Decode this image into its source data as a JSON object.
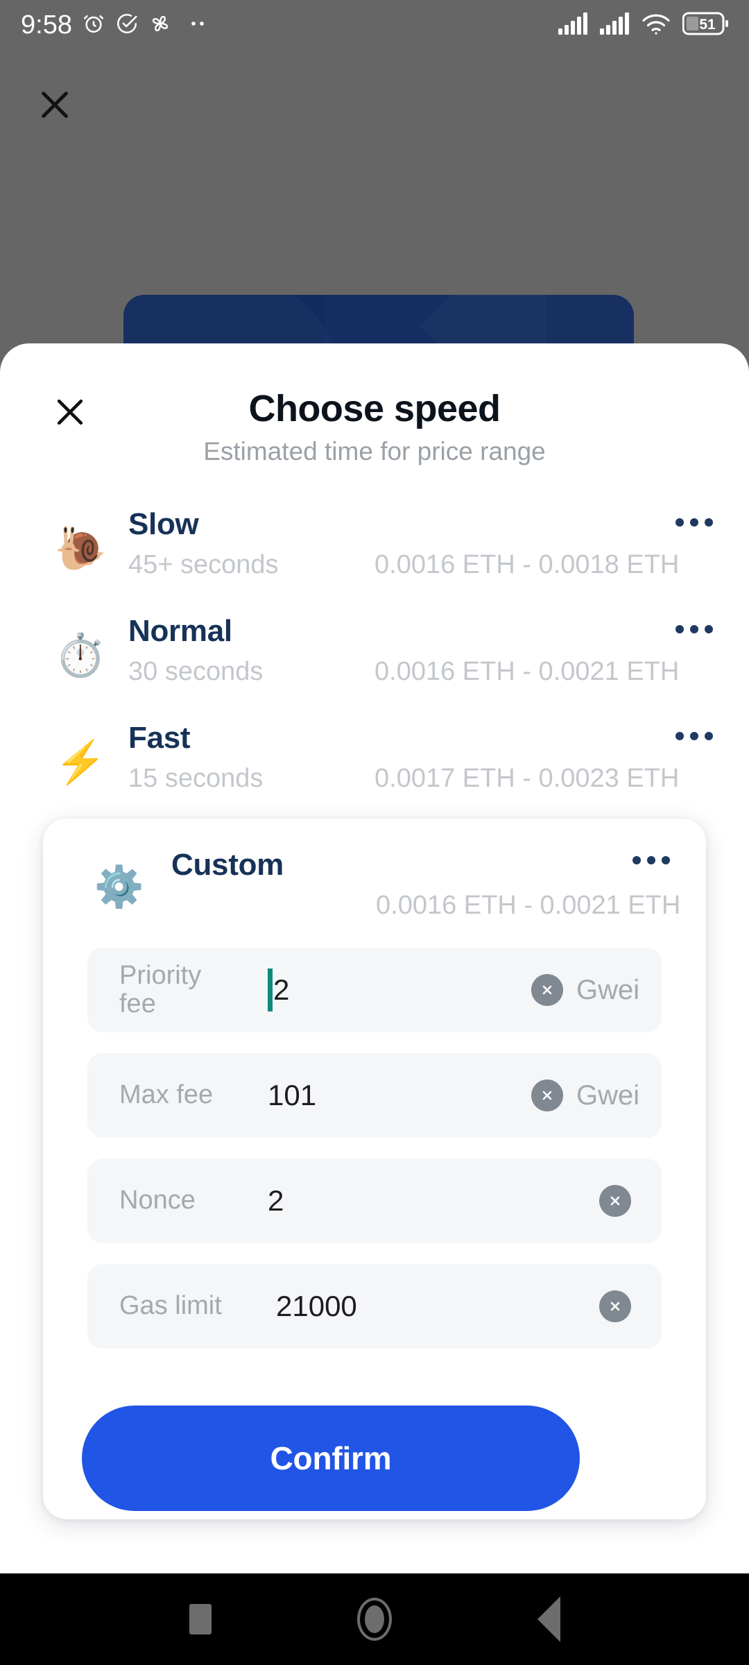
{
  "status_bar": {
    "time": "9:58",
    "left_icons": [
      "alarm-icon",
      "check-circle-icon",
      "pinwheel-icon",
      "more-dots-icon"
    ],
    "right_icons": [
      "signal-bars-1-icon",
      "signal-bars-2-icon",
      "wifi-icon"
    ],
    "battery_percent": "51"
  },
  "background": {
    "close_icon": "close-icon"
  },
  "sheet": {
    "close_icon": "close-icon",
    "title": "Choose speed",
    "subtitle": "Estimated time for price range"
  },
  "speed_options": [
    {
      "emoji": "🐌",
      "icon_name": "snail-icon",
      "name": "Slow",
      "time": "45+ seconds",
      "price_range": "0.0016 ETH - 0.0018 ETH",
      "menu_icon": "more-horizontal-icon"
    },
    {
      "emoji": "⏱️",
      "icon_name": "stopwatch-icon",
      "name": "Normal",
      "time": "30 seconds",
      "price_range": "0.0016 ETH - 0.0021 ETH",
      "menu_icon": "more-horizontal-icon"
    },
    {
      "emoji": "⚡",
      "icon_name": "lightning-bolt-icon",
      "name": "Fast",
      "time": "15 seconds",
      "price_range": "0.0017 ETH - 0.0023 ETH",
      "menu_icon": "more-horizontal-icon"
    }
  ],
  "custom": {
    "emoji": "⚙️",
    "icon_name": "gear-icon",
    "name": "Custom",
    "price_range": "0.0016 ETH - 0.0021 ETH",
    "menu_icon": "more-horizontal-icon",
    "fields": [
      {
        "label": "Priority fee",
        "label_line1": "Priority",
        "label_line2": "fee",
        "value": "2",
        "unit": "Gwei",
        "has_caret": true,
        "clear_icon": "clear-circle-icon"
      },
      {
        "label": "Max fee",
        "value": "101",
        "unit": "Gwei",
        "has_caret": false,
        "clear_icon": "clear-circle-icon"
      },
      {
        "label": "Nonce",
        "value": "2",
        "unit": "",
        "has_caret": false,
        "clear_icon": "clear-circle-icon"
      },
      {
        "label": "Gas limit",
        "value": "21000",
        "unit": "",
        "has_caret": false,
        "clear_icon": "clear-circle-icon"
      }
    ],
    "confirm_label": "Confirm"
  },
  "nav_bar": {
    "recents_icon": "square-recents-icon",
    "home_icon": "circle-home-icon",
    "back_icon": "triangle-back-icon"
  },
  "colors": {
    "accent_blue": "#2155e6",
    "navy": "#173258",
    "navy_card": "#122a5e",
    "muted": "#c3c7cc",
    "field_bg": "#f4f6f8",
    "caret_green": "#0e8a7d",
    "clear_gray": "#808891",
    "backdrop": "#666666"
  }
}
